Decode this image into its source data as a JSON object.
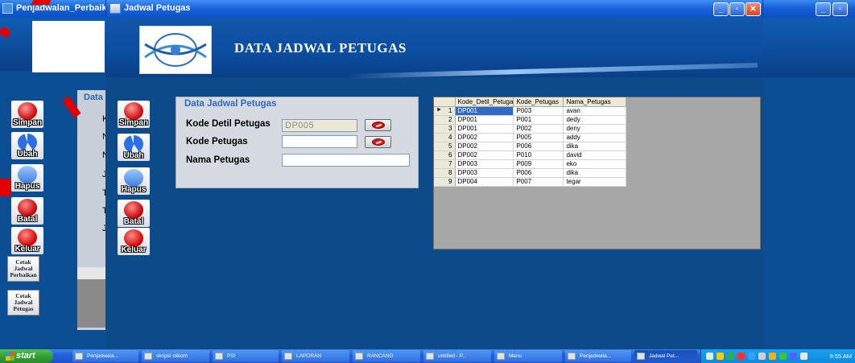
{
  "background_window": {
    "title": "Penjadwalan_Perbaik",
    "data_label": "Data",
    "letters": [
      "K",
      "N",
      "N",
      "J",
      "T",
      "T",
      "J"
    ]
  },
  "main_window": {
    "title": "Jadwal Petugas",
    "header_title": "DATA JADWAL PETUGAS"
  },
  "side_buttons": {
    "save": "Simpan",
    "edit": "Ubah",
    "delete": "Hapus",
    "cancel": "Batal",
    "exit": "Keluar",
    "print_repair": "Cetak Jadwal Perbaikan",
    "print_officer": "Cetak Jadwal Petugas"
  },
  "form": {
    "heading": "Data Jadwal Petugas",
    "kode_detil_label": "Kode Detil Petugas",
    "kode_detil_value": "DP005",
    "kode_petugas_label": "Kode Petugas",
    "kode_petugas_value": "",
    "nama_petugas_label": "Nama Petugas",
    "nama_petugas_value": ""
  },
  "grid": {
    "columns": [
      "Kode_Detil_Petuga",
      "Kode_Petugas",
      "Nama_Petugas"
    ],
    "rows": [
      [
        "1",
        "DP001",
        "P003",
        "avan"
      ],
      [
        "2",
        "DP001",
        "P001",
        "dedy"
      ],
      [
        "3",
        "DP001",
        "P002",
        "deny"
      ],
      [
        "4",
        "DP002",
        "P005",
        "addy"
      ],
      [
        "5",
        "DP002",
        "P006",
        "dika"
      ],
      [
        "6",
        "DP002",
        "P010",
        "david"
      ],
      [
        "7",
        "DP003",
        "P009",
        "eko"
      ],
      [
        "8",
        "DP003",
        "P006",
        "dika"
      ],
      [
        "9",
        "DP004",
        "P007",
        "tegar"
      ]
    ]
  },
  "taskbar": {
    "start": "start",
    "items": [
      "Penjadwala...",
      "skripsi stikom",
      "PSI",
      "LAPORAN",
      "RANCANG",
      "untitled - P...",
      "Menu",
      "Penjadwala...",
      "Jadwal Pet..."
    ],
    "clock": "9:55 AM"
  },
  "colors": {
    "accent": "#0c4a8a",
    "titlebar": "#1a64df",
    "selected_row": "#316ac5"
  }
}
